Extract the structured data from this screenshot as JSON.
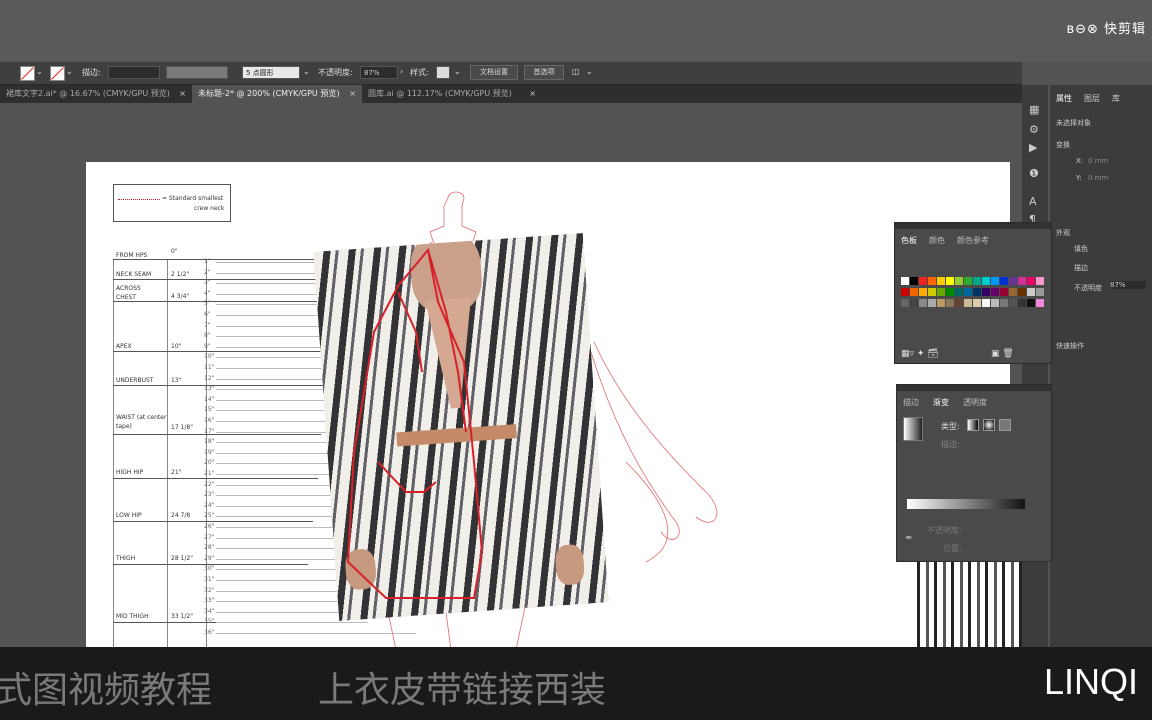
{
  "watermark": "ʙ⊖⊗ 快剪辑",
  "control_bar": {
    "stroke_label": "描边:",
    "brush_label": "5 点圆形",
    "opacity_label": "不透明度:",
    "opacity_value": "87%",
    "style_label": "样式:",
    "doc_setup_button": "文档设置",
    "preferences_button": "首选项"
  },
  "tabs": [
    {
      "label": "裙库文字2.ai* @ 16.67% (CMYK/GPU 预览)",
      "active": false
    },
    {
      "label": "未标题-2* @ 200% (CMYK/GPU 预览)",
      "active": true
    },
    {
      "label": "圆库.ai @ 112.17% (CMYK/GPU 预览)",
      "active": false
    }
  ],
  "legend_box": {
    "line1": "= Standard smallest",
    "line2": "crew neck"
  },
  "measurements": [
    {
      "label": "FROM HPS",
      "value": "0\""
    },
    {
      "label": "NECK SEAM",
      "value": "2 1/2\""
    },
    {
      "label": "ACROSS CHEST",
      "value": "4 3/4\""
    },
    {
      "label": "APEX",
      "value": "10\""
    },
    {
      "label": "UNDERBUST",
      "value": "13\""
    },
    {
      "label": "WAIST (at center tape)",
      "value": "17 1/8\""
    },
    {
      "label": "HIGH HIP",
      "value": "21\""
    },
    {
      "label": "LOW HIP",
      "value": "24 7/8"
    },
    {
      "label": "THIGH",
      "value": "28 1/2\""
    },
    {
      "label": "MID THIGH",
      "value": "33 1/2\""
    }
  ],
  "ruler_ticks": [
    "1\"",
    "2\"",
    "3\"",
    "4\"",
    "5\"",
    "6\"",
    "7\"",
    "8\"",
    "9\"",
    "10\"",
    "11\"",
    "12\"",
    "13\"",
    "14\"",
    "15\"",
    "16\"",
    "17\"",
    "18\"",
    "19\"",
    "20\"",
    "21\"",
    "22\"",
    "23\"",
    "24\"",
    "25\"",
    "26\"",
    "27\"",
    "28\"",
    "29\"",
    "30\"",
    "31\"",
    "32\"",
    "33\"",
    "34\"",
    "35\"",
    "36\""
  ],
  "swatches_panel": {
    "tabs": [
      "色板",
      "颜色",
      "颜色参考"
    ]
  },
  "gradient_panel": {
    "tabs": [
      "描边",
      "渐变",
      "透明度"
    ],
    "type_label": "类型:",
    "stroke_label": "描边:",
    "opacity_label": "不透明度:",
    "position_label": "位置:"
  },
  "properties_panel": {
    "tabs": [
      "属性",
      "图层",
      "库"
    ],
    "no_selection": "未选择对象",
    "transform": "变换",
    "x_label": "X:",
    "x_value": "0 mm",
    "y_label": "Y:",
    "y_value": "0 mm",
    "appearance": "外观",
    "fill_label": "填色",
    "stroke_label": "描边",
    "opacity_label": "不透明度",
    "opacity_value": "87%",
    "quick_actions": "快速操作"
  },
  "bottom_captions": {
    "left": "式图视频教程",
    "center": "上衣皮带链接西装",
    "right": "LINQI"
  },
  "colors": {
    "accent_red": "#d8202a",
    "ui_dark": "#3c3c3c",
    "canvas_bg": "#535353"
  }
}
